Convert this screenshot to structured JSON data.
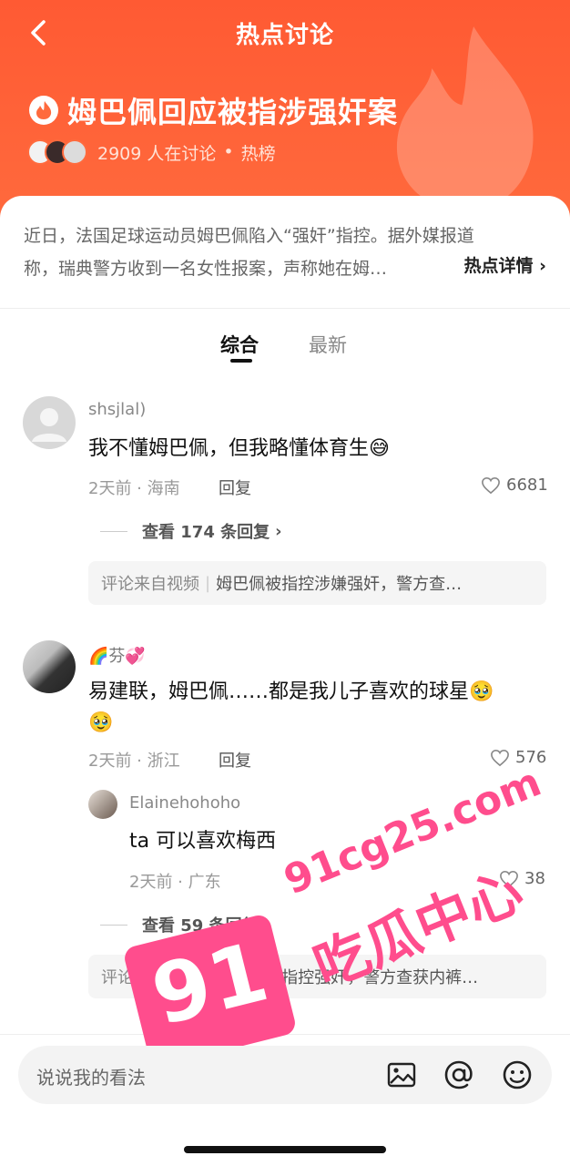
{
  "header": {
    "nav_title": "热点讨论",
    "topic_title": "姆巴佩回应被指涉强奸案",
    "discuss_count": "2909 人在讨论",
    "bullet": "•",
    "rank_label": "热榜"
  },
  "summary": {
    "line1": "近日，法国足球运动员姆巴佩陷入“强奸”指控。据外媒报道",
    "line2": "称，瑞典警方收到一名女性报案，声称她在姆…",
    "detail_link": "热点详情"
  },
  "tabs": [
    {
      "label": "综合",
      "active": true
    },
    {
      "label": "最新",
      "active": false
    }
  ],
  "comments": [
    {
      "username": "shsjlal)",
      "text": "我不懂姆巴佩，但我略懂体育生😅",
      "time_location": "2天前 · 海南",
      "reply_label": "回复",
      "likes": "6681",
      "view_replies": "查看 174 条回复",
      "source_prefix": "评论来自视频",
      "source_title": "姆巴佩被指控涉嫌强奸，警方查…"
    },
    {
      "username": "🌈芬💞",
      "text": "易建联，姆巴佩……都是我儿子喜欢的球星🥹",
      "text2": "🥹",
      "time_location": "2天前 · 浙江",
      "reply_label": "回复",
      "likes": "576",
      "reply": {
        "username": "Elainehohoho",
        "text": "ta 可以喜欢梅西",
        "time_location": "2天前 · 广东",
        "likes": "38"
      },
      "view_replies": "查看 59 条回复",
      "source_prefix": "评论来自视频",
      "source_title": "姆巴佩被指控强奸，警方查获内裤…"
    }
  ],
  "input_bar": {
    "placeholder": "说说我的看法",
    "icons": [
      "image-icon",
      "at-icon",
      "emoji-icon"
    ]
  },
  "watermark": {
    "domain": "91cg25.com",
    "badge": "91",
    "text": "吃瓜中心"
  },
  "colors": {
    "header_orange": "#ff5a33",
    "watermark_pink": "#ff4d8d"
  }
}
